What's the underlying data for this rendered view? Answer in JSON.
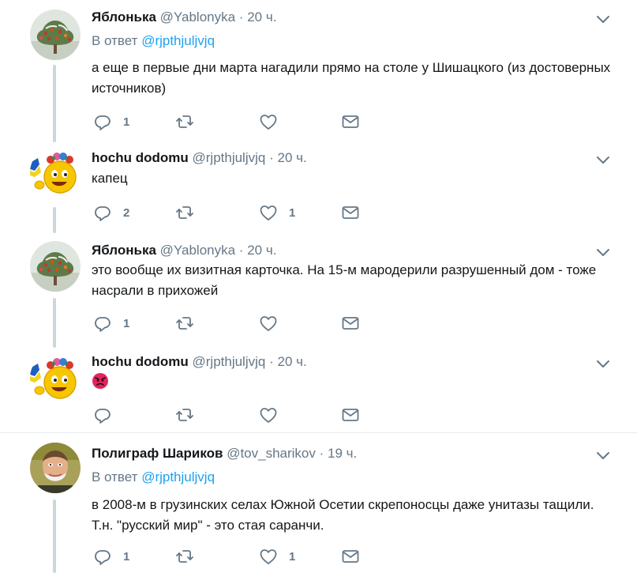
{
  "reply_prefix": "В ответ",
  "tweets": [
    {
      "name": "Яблонька",
      "handle": "@Yablonyka",
      "time": "20 ч.",
      "reply_to": "@rjpthjuljvjq",
      "text": "а еще в первые дни  марта нагадили прямо на столе у Шишацкого (из достоверных источников)",
      "replies": "1",
      "retweets": "",
      "likes": ""
    },
    {
      "name": "hochu dodomu",
      "handle": "@rjpthjuljvjq",
      "time": "20 ч.",
      "text": "капец",
      "replies": "2",
      "retweets": "",
      "likes": "1"
    },
    {
      "name": "Яблонька",
      "handle": "@Yablonyka",
      "time": "20 ч.",
      "text": "это вообще их визитная карточка. На 15-м мародерили разрушенный дом - тоже насрали в прихожей",
      "replies": "1",
      "retweets": "",
      "likes": ""
    },
    {
      "name": "hochu dodomu",
      "handle": "@rjpthjuljvjq",
      "time": "20 ч.",
      "emoji": "angry-face",
      "replies": "",
      "retweets": "",
      "likes": ""
    },
    {
      "name": "Полиграф Шариков",
      "handle": "@tov_sharikov",
      "time": "19 ч.",
      "reply_to": "@rjpthjuljvjq",
      "text": "в 2008-м в грузинских селах Южной Осетии скрепоносцы даже унитазы тащили. Т.н. \"русский мир\" - это стая саранчи.",
      "replies": "1",
      "retweets": "",
      "likes": "1"
    }
  ],
  "colors": {
    "text": "#14171a",
    "secondary": "#657786",
    "link": "#1da1f2",
    "thread_line": "#ccd6dd",
    "separator": "#e6ecf0",
    "angry_emoji": "#e0245e"
  },
  "icons": [
    "reply-icon",
    "retweet-icon",
    "like-icon",
    "message-icon",
    "caret-down-icon"
  ]
}
